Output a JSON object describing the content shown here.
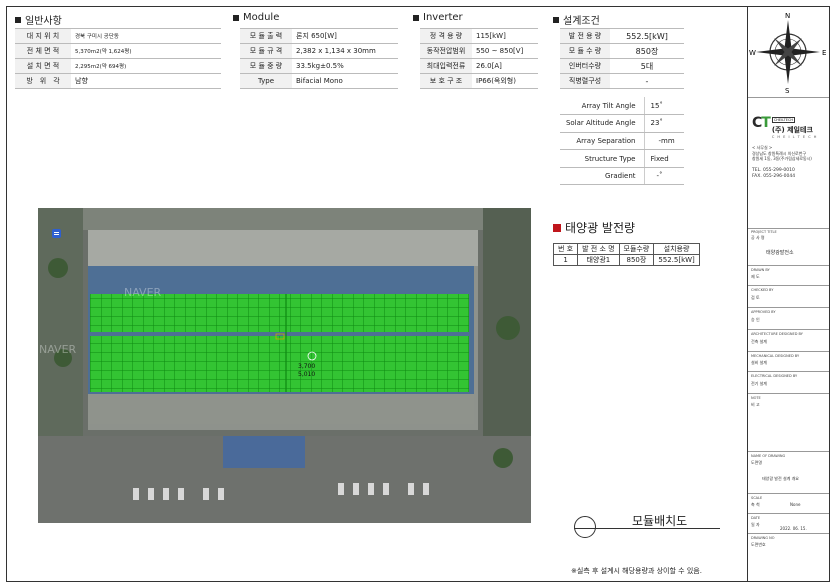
{
  "general": {
    "title": "일반사항",
    "rows": [
      {
        "key": "대 지 위 치",
        "value": "경북 구미시 공단동"
      },
      {
        "key": "전 체 면 적",
        "value": "5,370m2(약 1,624평)"
      },
      {
        "key": "설 치 면 적",
        "value": "2,295m2(약 694평)"
      },
      {
        "key": "방　위　각",
        "value": "남향"
      }
    ]
  },
  "module": {
    "title": "Module",
    "rows": [
      {
        "key": "모 듈 출 력",
        "value": "론지 650[W]"
      },
      {
        "key": "모 듈 규 격",
        "value": "2,382 x 1,134 x 30mm"
      },
      {
        "key": "모 듈 중 량",
        "value": "33.5kg±0.5%"
      },
      {
        "key": "Type",
        "value": "Bifacial Mono"
      }
    ]
  },
  "inverter": {
    "title": "Inverter",
    "rows": [
      {
        "key": "정 격 용 량",
        "value": "115[kW]"
      },
      {
        "key": "동작전압범위",
        "value": "550 ~ 850[V]"
      },
      {
        "key": "최대입력전류",
        "value": "26.0[A]"
      },
      {
        "key": "보 호 구 조",
        "value": "IP66(옥외형)"
      }
    ]
  },
  "design": {
    "title": "설계조건",
    "rows": [
      {
        "key": "발 전 용 량",
        "value": "552.5[kW]"
      },
      {
        "key": "모 듈 수 량",
        "value": "850장"
      },
      {
        "key": "인버터수량",
        "value": "5대"
      },
      {
        "key": "직병렬구성",
        "value": "-"
      }
    ],
    "array_rows": [
      {
        "key": "Array Tilt Angle",
        "value": "15˚"
      },
      {
        "key": "Solar Altitude Angle",
        "value": "23˚"
      },
      {
        "key": "Array Separation",
        "value": "-mm"
      },
      {
        "key": "Structure Type",
        "value": "Fixed"
      },
      {
        "key": "Gradient",
        "value": "-˚"
      }
    ]
  },
  "generation": {
    "title": "태양광 발전량",
    "headers": [
      "번 호",
      "발 전 소 명",
      "모듈수량",
      "설치용량"
    ],
    "rows": [
      [
        "1",
        "태양광1",
        "850장",
        "552.5[kW]"
      ]
    ]
  },
  "map": {
    "watermark": "NAVER",
    "marker_label": "①",
    "array_label_1": "3,700",
    "array_label_2": "5,010"
  },
  "layout": {
    "title": "모듈배치도",
    "note": "※실측 후 설계시 해당용량과 상이할 수 있음."
  },
  "compass": {
    "n": "N",
    "s": "S",
    "e": "E",
    "w": "W"
  },
  "company": {
    "badge": "CHEILTECH",
    "name": "(주) 제일테크",
    "eng": "C H E I L T E C H",
    "addr_label": "< 사무실 >",
    "addr_1": "경상남도 창원특례시 의신로번구",
    "addr_2": "창원세 1동, 3동(주가림삼세로동시)",
    "tel": "TEL. 055-299-0010",
    "fax": "FAX. 055-296-0044"
  },
  "titleblock": [
    {
      "cap": "PROJECT TITLE",
      "val": "공 사 명",
      "val2": "태양광발전소"
    },
    {
      "cap": "DRAWN BY",
      "val": "제 도"
    },
    {
      "cap": "CHECKED BY",
      "val": "검 토"
    },
    {
      "cap": "APPROVED BY",
      "val": "승 인"
    },
    {
      "cap": "ARCHITECTURE DESIGNED BY",
      "val": "건축 설계"
    },
    {
      "cap": "MECHANICAL DESIGNED BY",
      "val": "설비 설계"
    },
    {
      "cap": "ELECTRICAL DESIGNED BY",
      "val": "전기 설계"
    },
    {
      "cap": "NOTE",
      "val": "비 고"
    },
    {
      "cap": "NAME OF DRAWING",
      "val": "도면명",
      "val2": "태양광 발전 설계 개요"
    },
    {
      "cap": "SCALE",
      "val": "축 척",
      "val2": "None"
    },
    {
      "cap": "DATE",
      "val": "일 자",
      "val2": "2022. 06. 15."
    },
    {
      "cap": "DRAWING NO",
      "val": "도면번호"
    }
  ]
}
